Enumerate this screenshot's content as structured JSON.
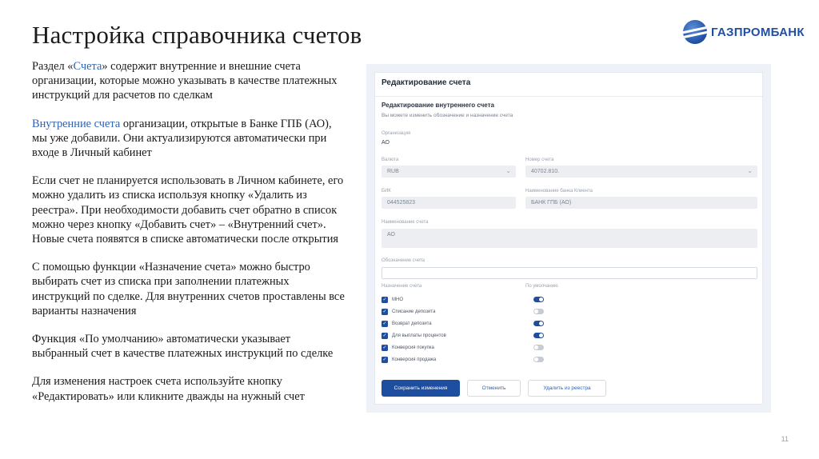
{
  "slide": {
    "title": "Настройка справочника счетов",
    "logo_text": "ГАЗПРОМБАНК",
    "page_number": "11"
  },
  "text": {
    "p1_a": "Раздел «",
    "p1_link": "Счета",
    "p1_b": "» содержит внутренние и внешние счета организации, которые можно указывать в качестве платежных инструкций для расчетов по сделкам",
    "p2_link": "Внутренние счета",
    "p2_b": " организации, открытые в Банке ГПБ (АО), мы уже добавили. Они актуализируются автоматически при входе в Личный кабинет",
    "p3": "Если счет не планируется использовать в Личном кабинете, его можно удалить из списка используя кнопку «Удалить из реестра». При необходимости добавить счет обратно в список можно через кнопку «Добавить счет» – «Внутренний счет».",
    "p3b": "Новые счета появятся в списке автоматически после открытия",
    "p4": "С помощью функции «Назначение счета» можно быстро выбирать счет из списка при заполнении платежных инструкций по сделке. Для внутренних счетов проставлены все варианты назначения",
    "p5": "Функция «По умолчанию» автоматически указывает выбранный счет в качестве платежных инструкций по сделке",
    "p6": "Для изменения настроек счета используйте кнопку «Редактировать» или кликните дважды на нужный счет"
  },
  "form": {
    "header": "Редактирование счета",
    "section_title": "Редактирование внутреннего счета",
    "section_sub": "Вы можете изменить обозначение и назначение счета",
    "org_label": "Организация",
    "org_value": "АО",
    "currency_label": "Валюта",
    "currency_value": "RUB",
    "account_label": "Номер счета",
    "account_value": "40702.810.",
    "bik_label": "БИК",
    "bik_value": "044525823",
    "bank_label": "Наименование банка Клиента",
    "bank_value": "БАНК ГПБ (АО)",
    "acc_name_label": "Наименование счета",
    "acc_name_value": "АО",
    "designation_label": "Обозначение счета",
    "purpose_label": "Назначение счета",
    "default_label": "По умолчанию",
    "purposes": [
      {
        "label": "МНО",
        "checked": true,
        "default": true
      },
      {
        "label": "Списание депозита",
        "checked": true,
        "default": false
      },
      {
        "label": "Возврат депозита",
        "checked": true,
        "default": true
      },
      {
        "label": "Для выплаты процентов",
        "checked": true,
        "default": true
      },
      {
        "label": "Конверсия покупка",
        "checked": true,
        "default": false
      },
      {
        "label": "Конверсия продажа",
        "checked": true,
        "default": false
      }
    ],
    "btn_save": "Сохранить изменения",
    "btn_cancel": "Отменить",
    "btn_delete": "Удалить из реестра",
    "accent_color": "#1e4ea0"
  }
}
